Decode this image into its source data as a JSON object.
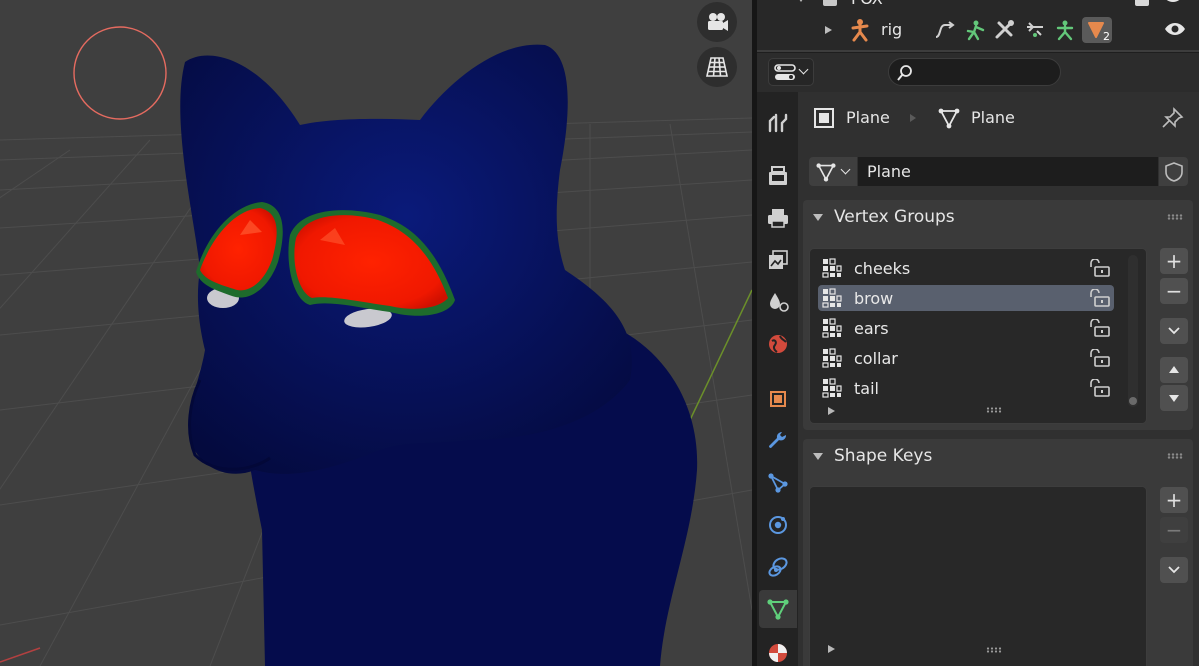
{
  "outliner": {
    "collection_label": "FOX",
    "rig_label": "rig",
    "modifier_badge_count": "2"
  },
  "properties": {
    "search_placeholder": "",
    "breadcrumb": {
      "object": "Plane",
      "data": "Plane"
    },
    "mesh_name": "Plane"
  },
  "vertex_groups": {
    "title": "Vertex Groups",
    "items": [
      {
        "name": "cheeks",
        "selected": false
      },
      {
        "name": "brow",
        "selected": true
      },
      {
        "name": "ears",
        "selected": false
      },
      {
        "name": "collar",
        "selected": false
      },
      {
        "name": "tail",
        "selected": false
      }
    ],
    "add_label": "+",
    "remove_label": "−"
  },
  "shape_keys": {
    "title": "Shape Keys",
    "add_label": "+",
    "remove_label": "−"
  },
  "colors": {
    "accent_orange": "#e6894d",
    "selection_blue": "#59606e",
    "mesh_blue": "#060f58",
    "weight_red": "#ff1a00",
    "brush_circle": "#e56b60"
  }
}
